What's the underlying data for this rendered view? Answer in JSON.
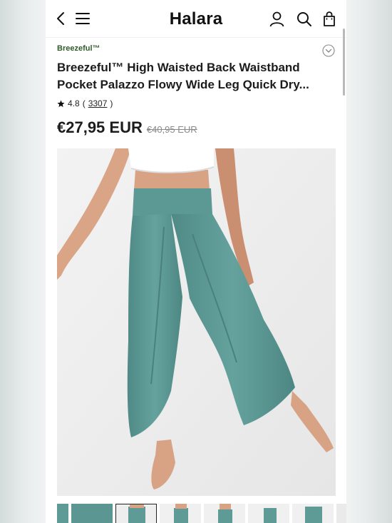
{
  "header": {
    "logo": "Halara",
    "icons": [
      "back-icon",
      "menu-icon",
      "account-icon",
      "search-icon",
      "bag-icon"
    ]
  },
  "product": {
    "brand": "Breezeful™",
    "title_line1": "Breezeful™ High Waisted Back Waistband",
    "title_line2": "Pocket Palazzo Flowy Wide Leg Quick Dry...",
    "rating": "4.8",
    "rating_open": "(",
    "review_count": "3307",
    "rating_close": ")",
    "price": "€27,95 EUR",
    "old_price": "€40,95 EUR"
  },
  "gallery": {
    "thumbnail_count": 7,
    "selected_index": 2
  },
  "colors": {
    "product_teal": "#5e9b97",
    "brand_green": "#2f5e2a"
  }
}
